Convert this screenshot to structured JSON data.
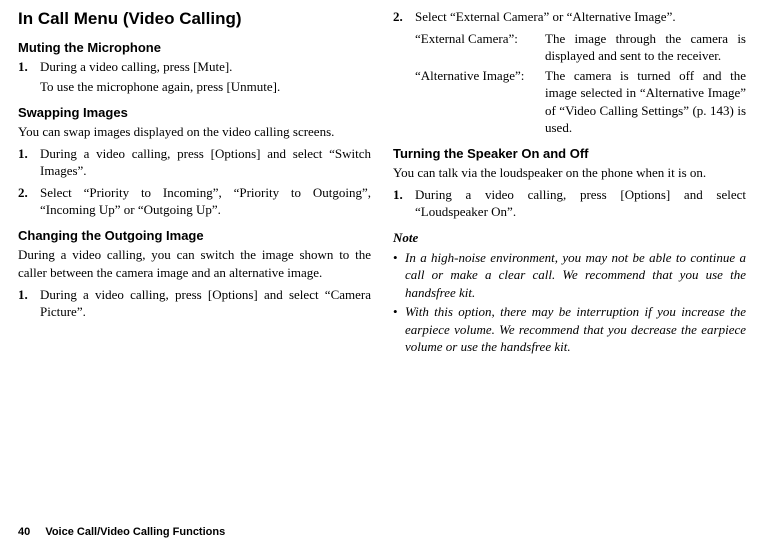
{
  "page_number": "40",
  "footer_chapter": "Voice Call/Video Calling Functions",
  "title": "In Call Menu (Video Calling)",
  "sections": {
    "muting": {
      "heading": "Muting the Microphone",
      "step1_marker": "1.",
      "step1_text": "During a video calling, press [Mute].",
      "step1_sub": "To use the microphone again, press [Unmute]."
    },
    "swapping": {
      "heading": "Swapping Images",
      "intro": "You can swap images displayed on the video calling screens.",
      "step1_marker": "1.",
      "step1_text": "During a video calling, press [Options] and select “Switch Images”.",
      "step2_marker": "2.",
      "step2_text": "Select “Priority to Incoming”, “Priority to Outgoing”, “Incoming Up” or “Outgoing Up”."
    },
    "outgoing": {
      "heading": "Changing the Outgoing Image",
      "intro": "During a video calling, you can switch the image shown to the caller between the camera image and an alternative image.",
      "step1_marker": "1.",
      "step1_text": "During a video calling, press [Options] and select “Camera Picture”."
    },
    "select": {
      "step2_marker": "2.",
      "step2_text": "Select “External Camera” or “Alternative Image”.",
      "def1_term": "“External Camera”:",
      "def1_desc": "The image through the camera is displayed and sent to the receiver.",
      "def2_term": "“Alternative Image”:",
      "def2_desc": "The camera is turned off and the image selected in “Alternative Image” of “Video Calling Settings” (p. 143) is used."
    },
    "speaker": {
      "heading": "Turning the Speaker On and Off",
      "intro": "You can talk via the loudspeaker on the phone when it is on.",
      "step1_marker": "1.",
      "step1_text": "During a video calling, press [Options] and select “Loudspeaker On”."
    },
    "note": {
      "heading": "Note",
      "item1": "In a high-noise environment, you may not be able to continue a call or make a clear call. We recommend that you use the handsfree kit.",
      "item2": "With this option, there may be interruption if you increase the earpiece volume. We recommend that you decrease the earpiece volume or use the handsfree kit."
    }
  }
}
